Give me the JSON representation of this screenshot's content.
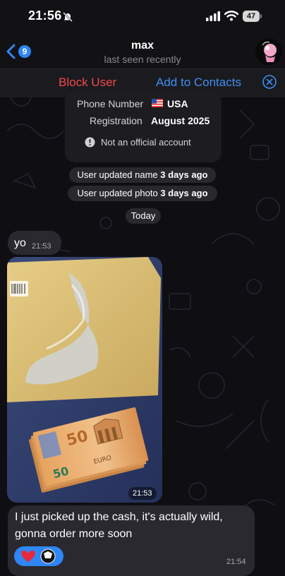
{
  "status_bar": {
    "time": "21:56",
    "battery": "47"
  },
  "header": {
    "back_count": "9",
    "name": "max",
    "status": "last seen recently"
  },
  "action_bar": {
    "block_label": "Block User",
    "add_label": "Add to Contacts"
  },
  "info_card": {
    "phone_label": "Phone Number",
    "phone_value": "USA",
    "registration_label": "Registration",
    "registration_value": "August 2025",
    "official_note": "Not an official account"
  },
  "service_messages": [
    {
      "text": "User updated name",
      "when": "3 days ago"
    },
    {
      "text": "User updated photo",
      "when": "3 days ago"
    }
  ],
  "date_separator": "Today",
  "messages": [
    {
      "text": "yo",
      "time": "21:53"
    },
    {
      "photo_time": "21:53"
    },
    {
      "line1": "I just picked up the cash, it's actually wild,",
      "line2": "gonna order more soon",
      "time": "21:54"
    }
  ],
  "colors": {
    "accent": "#2f86f4",
    "danger": "#f04a4a",
    "bubble": "#2a2930",
    "background": "#0f0e12"
  },
  "icons": [
    "back-chevron-icon",
    "muted-bell-icon",
    "signal-icon",
    "wifi-icon",
    "close-circle-icon",
    "info-icon",
    "us-flag-icon",
    "heart-reaction-icon"
  ]
}
